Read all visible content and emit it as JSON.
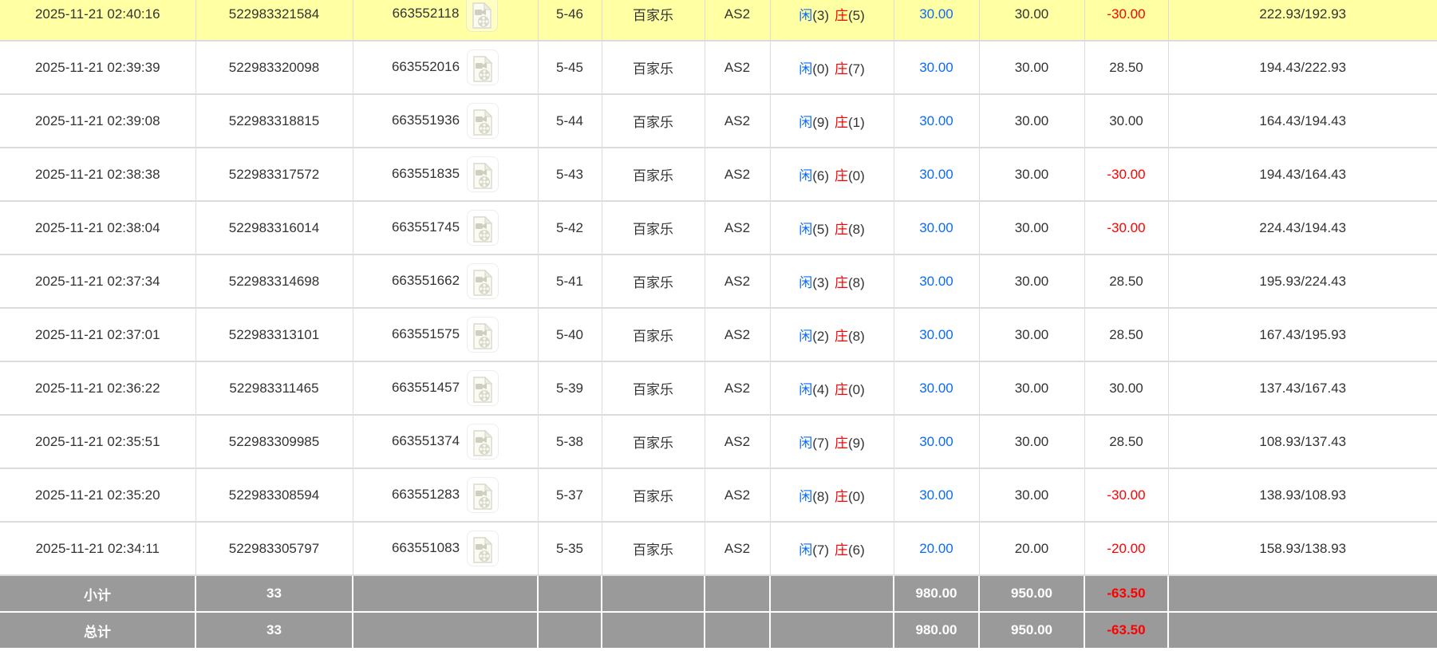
{
  "colors": {
    "highlight_row_bg": "#FFFFA3",
    "accent_blue": "#0B6BF8",
    "negative_red": "#FF0000",
    "summary_row_bg": "#9A9A9A",
    "row_border": "#DCDCDC"
  },
  "icons": {
    "video_replay": "video-file-icon"
  },
  "table": {
    "rows": [
      {
        "time": "2025-11-21 02:40:16",
        "order_id": "522983321584",
        "game_id": "663552118",
        "round": "5-46",
        "game_type": "百家乐",
        "table_name": "AS2",
        "result": {
          "xian": "闲",
          "xian_score": "(3)",
          "zhuang": "庄",
          "zhuang_score": "(5)"
        },
        "bet": "30.00",
        "valid": "30.00",
        "winloss": "-30.00",
        "balance": "222.93/192.93",
        "highlighted": true
      },
      {
        "time": "2025-11-21 02:39:39",
        "order_id": "522983320098",
        "game_id": "663552016",
        "round": "5-45",
        "game_type": "百家乐",
        "table_name": "AS2",
        "result": {
          "xian": "闲",
          "xian_score": "(0)",
          "zhuang": "庄",
          "zhuang_score": "(7)"
        },
        "bet": "30.00",
        "valid": "30.00",
        "winloss": "28.50",
        "balance": "194.43/222.93",
        "highlighted": false
      },
      {
        "time": "2025-11-21 02:39:08",
        "order_id": "522983318815",
        "game_id": "663551936",
        "round": "5-44",
        "game_type": "百家乐",
        "table_name": "AS2",
        "result": {
          "xian": "闲",
          "xian_score": "(9)",
          "zhuang": "庄",
          "zhuang_score": "(1)"
        },
        "bet": "30.00",
        "valid": "30.00",
        "winloss": "30.00",
        "balance": "164.43/194.43",
        "highlighted": false
      },
      {
        "time": "2025-11-21 02:38:38",
        "order_id": "522983317572",
        "game_id": "663551835",
        "round": "5-43",
        "game_type": "百家乐",
        "table_name": "AS2",
        "result": {
          "xian": "闲",
          "xian_score": "(6)",
          "zhuang": "庄",
          "zhuang_score": "(0)"
        },
        "bet": "30.00",
        "valid": "30.00",
        "winloss": "-30.00",
        "balance": "194.43/164.43",
        "highlighted": false
      },
      {
        "time": "2025-11-21 02:38:04",
        "order_id": "522983316014",
        "game_id": "663551745",
        "round": "5-42",
        "game_type": "百家乐",
        "table_name": "AS2",
        "result": {
          "xian": "闲",
          "xian_score": "(5)",
          "zhuang": "庄",
          "zhuang_score": "(8)"
        },
        "bet": "30.00",
        "valid": "30.00",
        "winloss": "-30.00",
        "balance": "224.43/194.43",
        "highlighted": false
      },
      {
        "time": "2025-11-21 02:37:34",
        "order_id": "522983314698",
        "game_id": "663551662",
        "round": "5-41",
        "game_type": "百家乐",
        "table_name": "AS2",
        "result": {
          "xian": "闲",
          "xian_score": "(3)",
          "zhuang": "庄",
          "zhuang_score": "(8)"
        },
        "bet": "30.00",
        "valid": "30.00",
        "winloss": "28.50",
        "balance": "195.93/224.43",
        "highlighted": false
      },
      {
        "time": "2025-11-21 02:37:01",
        "order_id": "522983313101",
        "game_id": "663551575",
        "round": "5-40",
        "game_type": "百家乐",
        "table_name": "AS2",
        "result": {
          "xian": "闲",
          "xian_score": "(2)",
          "zhuang": "庄",
          "zhuang_score": "(8)"
        },
        "bet": "30.00",
        "valid": "30.00",
        "winloss": "28.50",
        "balance": "167.43/195.93",
        "highlighted": false
      },
      {
        "time": "2025-11-21 02:36:22",
        "order_id": "522983311465",
        "game_id": "663551457",
        "round": "5-39",
        "game_type": "百家乐",
        "table_name": "AS2",
        "result": {
          "xian": "闲",
          "xian_score": "(4)",
          "zhuang": "庄",
          "zhuang_score": "(0)"
        },
        "bet": "30.00",
        "valid": "30.00",
        "winloss": "30.00",
        "balance": "137.43/167.43",
        "highlighted": false
      },
      {
        "time": "2025-11-21 02:35:51",
        "order_id": "522983309985",
        "game_id": "663551374",
        "round": "5-38",
        "game_type": "百家乐",
        "table_name": "AS2",
        "result": {
          "xian": "闲",
          "xian_score": "(7)",
          "zhuang": "庄",
          "zhuang_score": "(9)"
        },
        "bet": "30.00",
        "valid": "30.00",
        "winloss": "28.50",
        "balance": "108.93/137.43",
        "highlighted": false
      },
      {
        "time": "2025-11-21 02:35:20",
        "order_id": "522983308594",
        "game_id": "663551283",
        "round": "5-37",
        "game_type": "百家乐",
        "table_name": "AS2",
        "result": {
          "xian": "闲",
          "xian_score": "(8)",
          "zhuang": "庄",
          "zhuang_score": "(0)"
        },
        "bet": "30.00",
        "valid": "30.00",
        "winloss": "-30.00",
        "balance": "138.93/108.93",
        "highlighted": false
      },
      {
        "time": "2025-11-21 02:34:11",
        "order_id": "522983305797",
        "game_id": "663551083",
        "round": "5-35",
        "game_type": "百家乐",
        "table_name": "AS2",
        "result": {
          "xian": "闲",
          "xian_score": "(7)",
          "zhuang": "庄",
          "zhuang_score": "(6)"
        },
        "bet": "20.00",
        "valid": "20.00",
        "winloss": "-20.00",
        "balance": "158.93/138.93",
        "highlighted": false
      }
    ],
    "summary_rows": [
      {
        "label": "小计",
        "count": "33",
        "bet": "980.00",
        "valid": "950.00",
        "winloss": "-63.50"
      },
      {
        "label": "总计",
        "count": "33",
        "bet": "980.00",
        "valid": "950.00",
        "winloss": "-63.50"
      }
    ]
  }
}
